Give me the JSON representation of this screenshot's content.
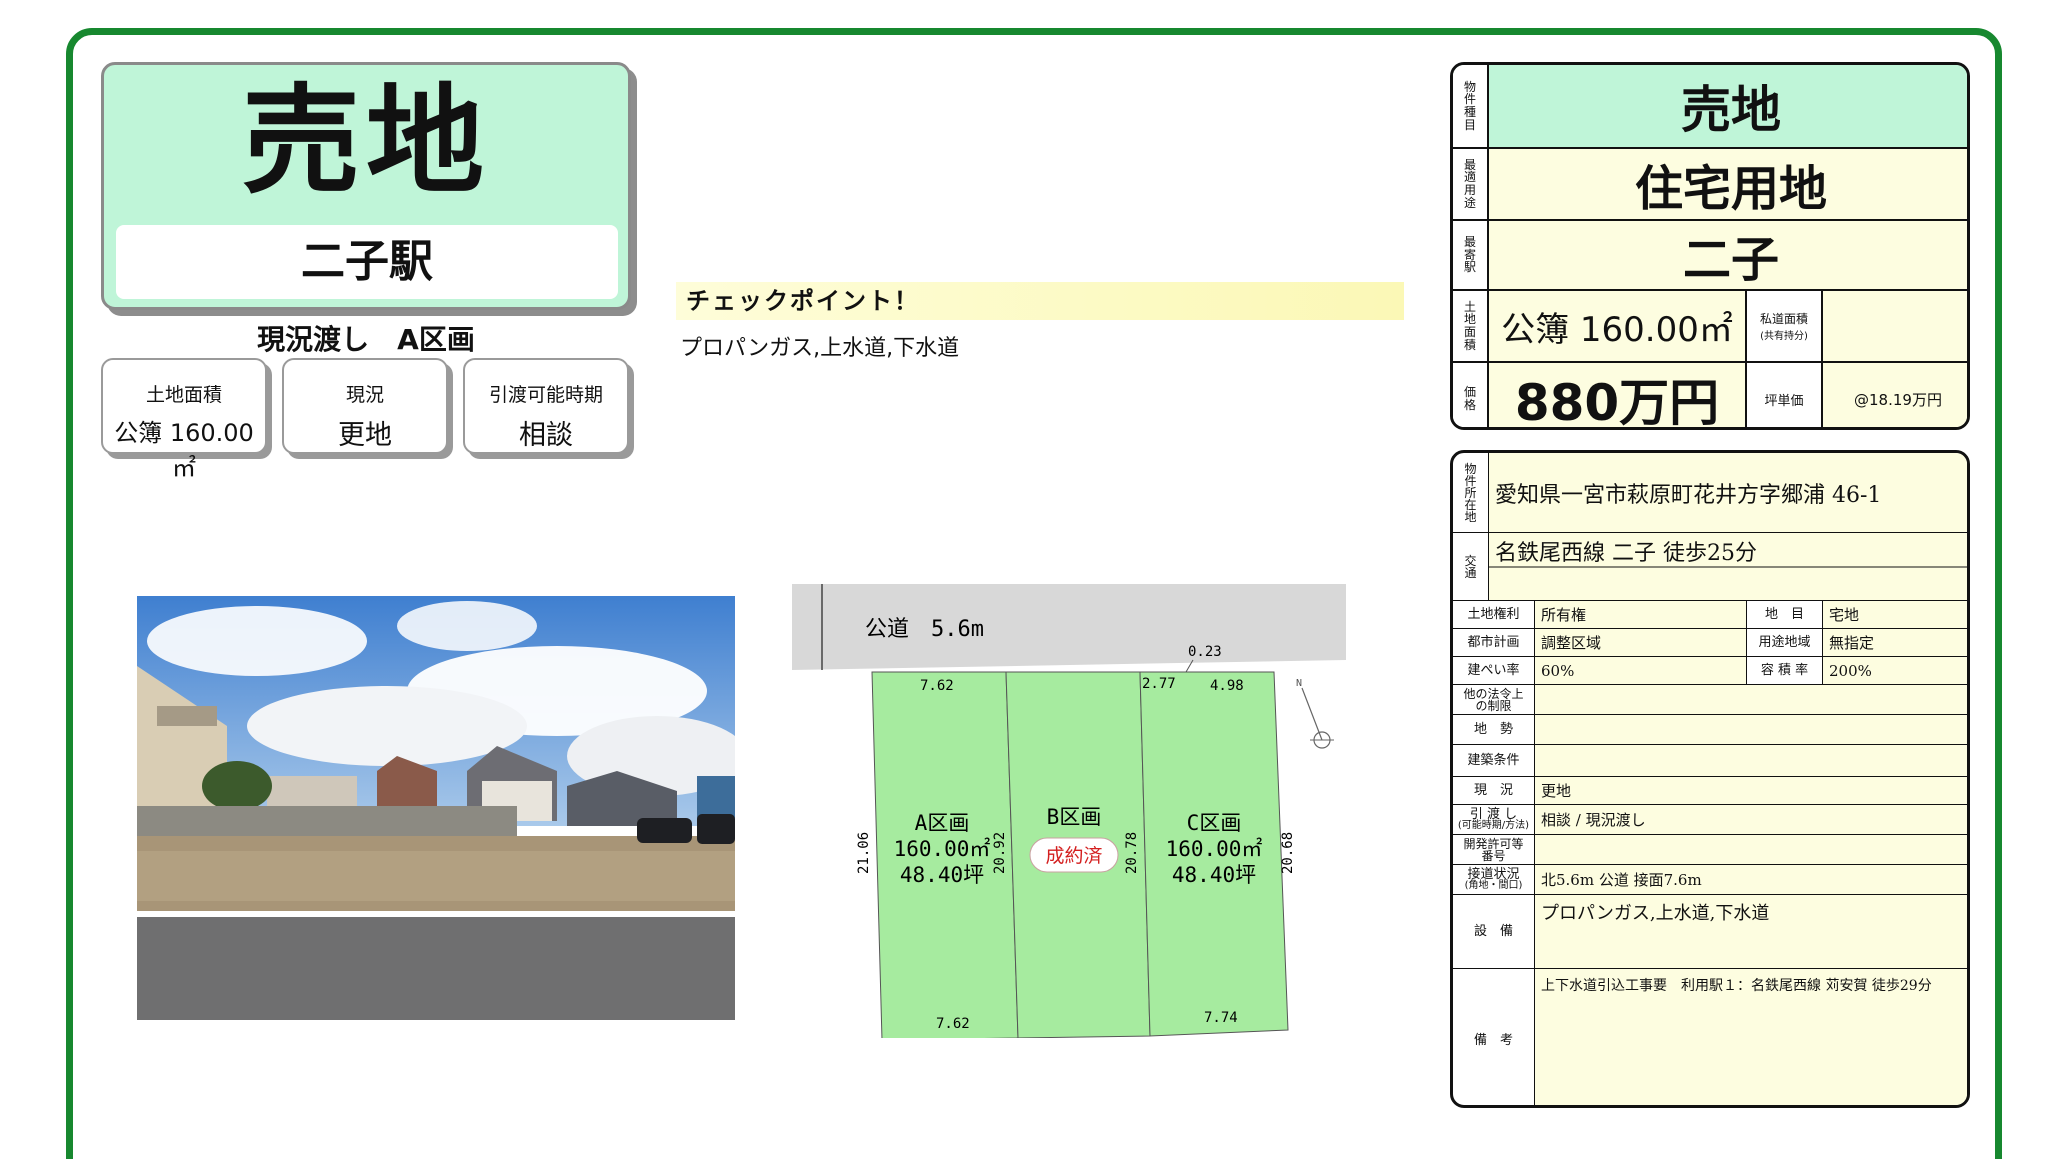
{
  "title": {
    "main": "売地",
    "station": "二子駅"
  },
  "subhead": "現況渡し　A区画",
  "info": [
    {
      "label": "土地面積",
      "value": "公簿 160.00㎡"
    },
    {
      "label": "現況",
      "value": "更地"
    },
    {
      "label": "引渡可能時期",
      "value": "相談"
    }
  ],
  "checkpoint": {
    "heading": "チェックポイント！",
    "text": "プロパンガス,上水道,下水道"
  },
  "plot": {
    "road": "公道　5.6m",
    "dims": {
      "top_a": "7.62",
      "top_c1": "2.77",
      "top_c2": "4.98",
      "corner": "0.23",
      "bottom_a": "7.62",
      "bottom_c": "7.74",
      "left_a": "21.06",
      "ab": "20.92",
      "bc": "20.78",
      "right_c": "20.68"
    },
    "lots": [
      {
        "name": "A区画",
        "area": "160.00㎡",
        "tsubo": "48.40坪"
      },
      {
        "name": "B区画",
        "status": "成約済"
      },
      {
        "name": "C区画",
        "area": "160.00㎡",
        "tsubo": "48.40坪"
      }
    ],
    "north": "N"
  },
  "spec": {
    "labels": {
      "type": "物件種目",
      "use": "最適用途",
      "station": "最寄駅",
      "area": "土地面積",
      "price": "価格"
    },
    "type": "売地",
    "use": "住宅用地",
    "station": "二子",
    "area": "公簿 160.00㎡",
    "private_road_label": "私道面積",
    "private_road_sub": "(共有持分)",
    "price": "880万円",
    "tsubo_label": "坪単価",
    "tsubo_price": "@18.19万円"
  },
  "detail": {
    "location_label": "物件所在地",
    "location": "愛知県一宮市萩原町花井方字郷浦 46-1",
    "access_label": "交通",
    "access": "名鉄尾西線 二子 徒歩25分",
    "rows": [
      {
        "l1": "土地権利",
        "v1": "所有権",
        "l2": "地　目",
        "v2": "宅地"
      },
      {
        "l1": "都市計画",
        "v1": "調整区域",
        "l2": "用途地域",
        "v2": "無指定"
      },
      {
        "l1": "建ぺい率",
        "v1": "60%",
        "l2": "容 積 率",
        "v2": "200%"
      }
    ],
    "legal_label": "他の法令上の制限",
    "terrain_label": "地　勢",
    "building_label": "建築条件",
    "status_label": "現　況",
    "status": "更地",
    "handover_label": "引 渡 し",
    "handover_sub": "(可能時期/方法)",
    "handover": "相談 / 現況渡し",
    "dev_label": "開発許可等番号",
    "road_label": "接道状況",
    "road_sub": "(角地・間口)",
    "road": "北5.6m 公道 接面7.6m",
    "facility_label": "設　備",
    "facility": "プロパンガス,上水道,下水道",
    "remarks_label": "備　考",
    "remarks": "上下水道引込工事要　利用駅１：名鉄尾西線 苅安賀 徒歩29分"
  }
}
